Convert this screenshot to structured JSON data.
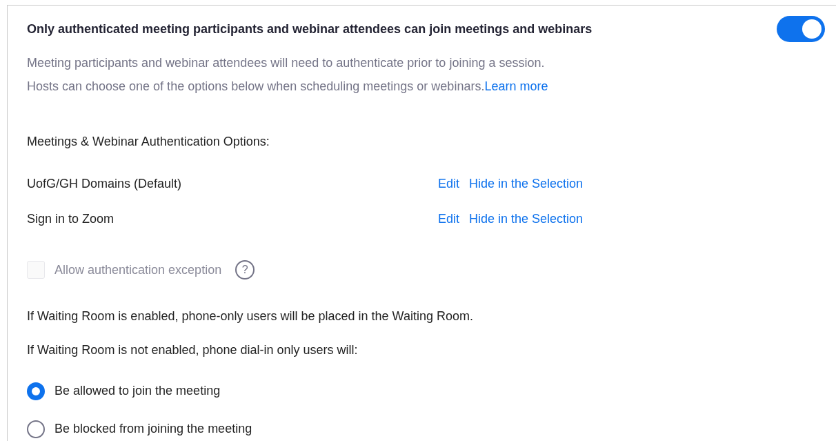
{
  "setting": {
    "title": "Only authenticated meeting participants and webinar attendees can join meetings and webinars",
    "on": true,
    "description": [
      "Meeting participants and webinar attendees will need to authenticate prior to joining a session.",
      "Hosts can choose one of the options below when scheduling meetings or webinars."
    ],
    "link": "Learn more"
  },
  "options_heading": "Meetings & Webinar Authentication Options:",
  "options": [
    {
      "name": "UofG/GH Domains (Default)",
      "actions": [
        "Edit",
        "Hide in the Selection"
      ]
    },
    {
      "name": "Sign in to Zoom",
      "actions": [
        "Edit",
        "Hide in the Selection"
      ]
    }
  ],
  "exception": {
    "label": "Allow authentication exception",
    "checked": false,
    "disabled": true,
    "help": "?"
  },
  "notes": [
    "If Waiting Room is enabled, phone-only users will be placed in the Waiting Room.",
    "If Waiting Room is not enabled, phone dial-in only users will:"
  ],
  "choices": [
    {
      "label": "Be allowed to join the meeting",
      "selected": true
    },
    {
      "label": "Be blocked from joining the meeting",
      "selected": false
    }
  ]
}
